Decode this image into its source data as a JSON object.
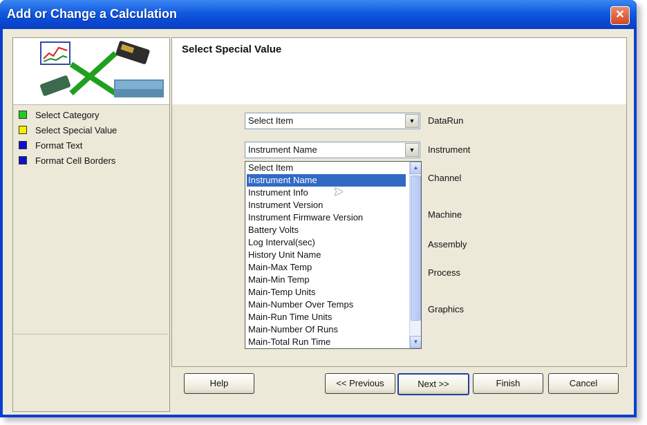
{
  "window": {
    "title": "Add or Change a Calculation",
    "close_glyph": "✕"
  },
  "steps": [
    {
      "label": "Select Category",
      "color": "#22cc22"
    },
    {
      "label": "Select Special Value",
      "color": "#f2f200"
    },
    {
      "label": "Format Text",
      "color": "#1010cc"
    },
    {
      "label": "Format Cell Borders",
      "color": "#1010cc"
    }
  ],
  "panel": {
    "title": "Select Special Value",
    "combo1": {
      "value": "Select Item",
      "label": "DataRun"
    },
    "combo2": {
      "value": "Instrument Name",
      "label": "Instrument"
    },
    "labels": {
      "channel": "Channel",
      "machine": "Machine",
      "assembly": "Assembly",
      "process": "Process",
      "graphics": "Graphics"
    }
  },
  "dropdown": {
    "options": [
      "Select Item",
      "Instrument Name",
      "Instrument Info",
      "Instrument Version",
      "Instrument Firmware Version",
      "Battery Volts",
      "Log Interval(sec)",
      "History Unit Name",
      "Main-Max Temp",
      "Main-Min Temp",
      "Main-Temp Units",
      "Main-Number Over Temps",
      "Main-Run Time Units",
      "Main-Number Of Runs",
      "Main-Total Run Time"
    ],
    "selected": "Instrument Name"
  },
  "buttons": {
    "help": "Help",
    "previous": "<< Previous",
    "next": "Next >>",
    "finish": "Finish",
    "cancel": "Cancel"
  }
}
